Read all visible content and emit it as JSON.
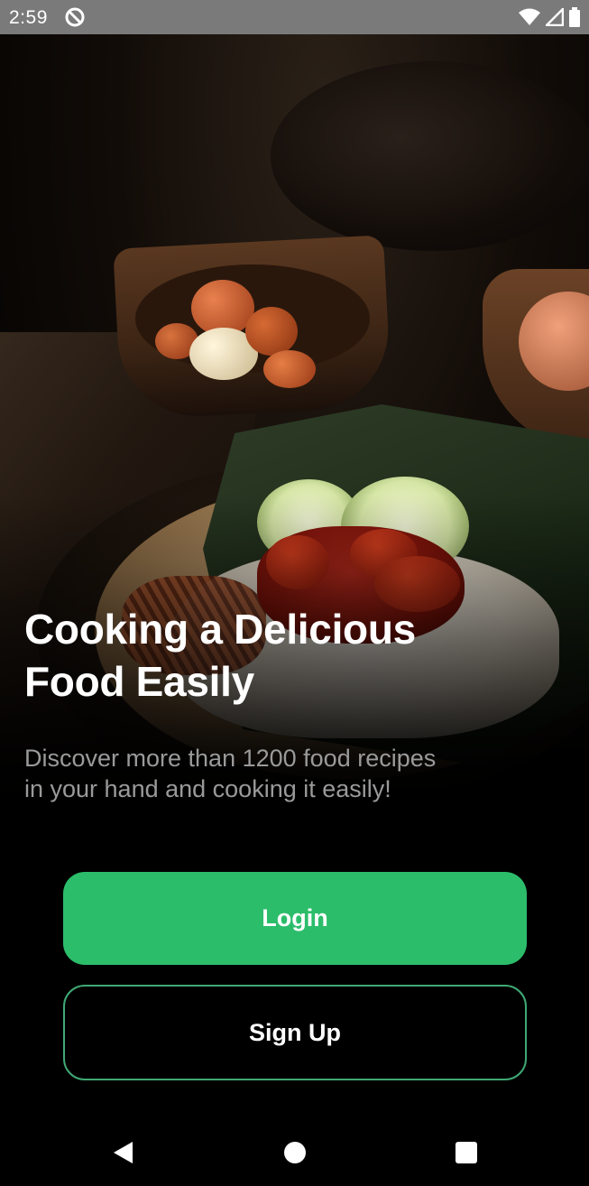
{
  "status_bar": {
    "time": "2:59",
    "icons": [
      "do-not-disturb-icon",
      "wifi-icon",
      "cell-signal-icon",
      "battery-icon"
    ]
  },
  "hero": {
    "image": "food-photo"
  },
  "content": {
    "headline_line1": "Cooking a Delicious",
    "headline_line2": "Food Easily",
    "description": "Discover more than 1200 food recipes in your hand and cooking it easily!"
  },
  "buttons": {
    "login_label": "Login",
    "signup_label": "Sign Up"
  },
  "colors": {
    "accent": "#2cbd6a",
    "signup_border": "#3fa874",
    "background": "#000000",
    "description_text": "#9a9a9a"
  },
  "nav_bar": {
    "icons": [
      "back-icon",
      "home-icon",
      "recents-icon"
    ]
  }
}
